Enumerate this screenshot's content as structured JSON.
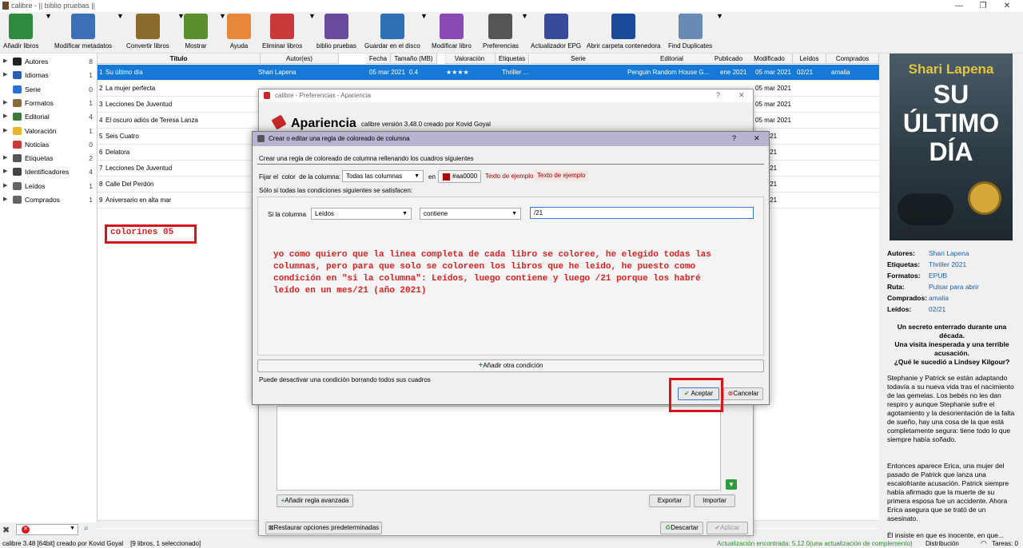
{
  "window": {
    "title": "calibre - || biblio pruebas ||",
    "min": "—",
    "max": "❐",
    "close": "✕"
  },
  "toolbar": [
    {
      "label": "Añadir libros",
      "color": "#2e8b3e",
      "dd": true
    },
    {
      "label": "Modificar metadatos",
      "color": "#3b6fb6",
      "dd": true
    },
    {
      "label": "Convertir libros",
      "color": "#8b6a2e",
      "dd": true
    },
    {
      "label": "Mostrar",
      "color": "#5a8f2e",
      "dd": true
    },
    {
      "label": "Ayuda",
      "color": "#e8873a",
      "dd": false
    },
    {
      "label": "Eliminar libros",
      "color": "#c93a3a",
      "dd": true
    },
    {
      "label": "biblio pruebas",
      "color": "#6a4a9a",
      "dd": false
    },
    {
      "label": "Guardar en el disco",
      "color": "#2e6fb6",
      "dd": true
    },
    {
      "label": "Modificar libro",
      "color": "#8a4ab6",
      "dd": false
    },
    {
      "label": "Preferencias",
      "color": "#555555",
      "dd": true
    },
    {
      "label": "Actualizador EPG",
      "color": "#3a4a9a",
      "dd": false
    },
    {
      "label": "Abrir carpeta contenedora",
      "color": "#1a4a9a",
      "dd": false
    },
    {
      "label": "Find Duplicates",
      "color": "#6a8ab6",
      "dd": true
    }
  ],
  "sidebar": [
    {
      "name": "Autores",
      "count": "8",
      "color": "#222222"
    },
    {
      "name": "Idiomas",
      "count": "1",
      "color": "#2e5fb6"
    },
    {
      "name": "Serie",
      "count": "0",
      "color": "#2e6fd6"
    },
    {
      "name": "Formatos",
      "count": "1",
      "color": "#8a6a3a"
    },
    {
      "name": "Editorial",
      "count": "4",
      "color": "#3a7a3a"
    },
    {
      "name": "Valoración",
      "count": "1",
      "color": "#e6b82e"
    },
    {
      "name": "Noticias",
      "count": "0",
      "color": "#c93a3a"
    },
    {
      "name": "Etiquetas",
      "count": "2",
      "color": "#555555"
    },
    {
      "name": "Identificadores",
      "count": "4",
      "color": "#444444"
    },
    {
      "name": "Leídos",
      "count": "1",
      "color": "#666666"
    },
    {
      "name": "Comprados",
      "count": "1",
      "color": "#666666"
    }
  ],
  "columns": [
    "Título",
    "Autor(es)",
    "Fecha",
    "Tamaño (MB)",
    "Valoración",
    "Etiquetas",
    "Serie",
    "Editorial",
    "Publicado",
    "Modificado",
    "Leídos",
    "Comprados"
  ],
  "rows": [
    {
      "n": "1",
      "title": "Su último día",
      "author": "Shari Lapena",
      "date": "05 mar 2021",
      "size": "0.4",
      "rating": "★★★★",
      "tags": "Thriller ...",
      "publisher": "Penguin Random House G...",
      "published": "ene 2021",
      "modified": "05 mar 2021",
      "read": "02/21",
      "bought": "amalia"
    },
    {
      "n": "2",
      "title": "La mujer perfecta",
      "author": "",
      "date": "",
      "size": "",
      "rating": "",
      "tags": "",
      "publisher": "",
      "published": "",
      "modified": "05 mar 2021",
      "read": "",
      "bought": ""
    },
    {
      "n": "3",
      "title": "Lecciones De Juventud",
      "author": "",
      "date": "",
      "size": "",
      "rating": "",
      "tags": "",
      "publisher": "",
      "published": "",
      "modified": "05 mar 2021",
      "read": "",
      "bought": ""
    },
    {
      "n": "4",
      "title": "El oscuro adiós de Teresa Lanza",
      "author": "",
      "date": "",
      "size": "",
      "rating": "",
      "tags": "",
      "publisher": "",
      "published": "",
      "modified": "05 mar 2021",
      "read": "",
      "bought": ""
    },
    {
      "n": "5",
      "title": "Seis Cuatro",
      "author": "",
      "date": "",
      "size": "",
      "rating": "",
      "tags": "",
      "publisher": "",
      "published": "",
      "modified": "ar 2021",
      "read": "",
      "bought": ""
    },
    {
      "n": "6",
      "title": "Delatora",
      "author": "",
      "date": "",
      "size": "",
      "rating": "",
      "tags": "",
      "publisher": "",
      "published": "",
      "modified": "ar 2021",
      "read": "",
      "bought": ""
    },
    {
      "n": "7",
      "title": "Lecciones De Juventud",
      "author": "",
      "date": "",
      "size": "",
      "rating": "",
      "tags": "",
      "publisher": "",
      "published": "",
      "modified": "ar 2021",
      "read": "",
      "bought": ""
    },
    {
      "n": "8",
      "title": "Calle Del Perdón",
      "author": "",
      "date": "",
      "size": "",
      "rating": "",
      "tags": "",
      "publisher": "",
      "published": "",
      "modified": "ar 2021",
      "read": "",
      "bought": ""
    },
    {
      "n": "9",
      "title": "Aniversario en alta mar",
      "author": "",
      "date": "",
      "size": "",
      "rating": "",
      "tags": "",
      "publisher": "",
      "published": "",
      "modified": "ar 2021",
      "read": "",
      "bought": ""
    }
  ],
  "annotation_label": "colorines 05",
  "cover": {
    "author": "Shari Lapena",
    "title1": "SU",
    "title2": "ÚLTIMO",
    "title3": "DÍA"
  },
  "details": {
    "autores_k": "Autores:",
    "autores_v": "Shari Lapena",
    "etiquetas_k": "Etiquetas:",
    "etiquetas_v": "Thriller 2021",
    "formatos_k": "Formatos:",
    "formatos_v": "EPUB",
    "ruta_k": "Ruta:",
    "ruta_v": "Pulsar para abrir",
    "comprados_k": "Comprados:",
    "comprados_v": "amalia",
    "leidos_k": "Leídos:",
    "leidos_v": "02/21",
    "bold1": "Un secreto enterrado durante una década.",
    "bold2": "Una visita inesperada y una terrible acusación.",
    "bold3": "¿Qué le sucedió a Lindsey Kilgour?",
    "p1": "Stephanie y Patrick se están adaptando todavía a su nueva vida tras el nacimiento de las gemelas. Los bebés no les dan respiro y aunque Stephanie sufre el agotamiento y la desorientación de la falta de sueño, hay una cosa de la que está completamente segura: tiene todo lo que siempre había soñado.",
    "p2": "Entonces aparece Erica, una mujer del pasado de Patrick que lanza una escalofriante acusación. Patrick siempre había afirmado que la muerte de su primera esposa fue un accidente. Ahora Erica asegura que se trató de un asesinato.",
    "p3": "Él insiste en que es inocente, en que..."
  },
  "prefs": {
    "title": "calibre - Preferencias - Apariencia",
    "heading": "Apariencia",
    "version": "calibre versión 3.48.0 creado por Kovid Goyal",
    "add_adv": "Añadir regla avanzada",
    "export": "Exportar",
    "import": "Importar",
    "restore": "Restaurar opciones predeterminadas",
    "discard": "Descartar",
    "apply": "Aplicar"
  },
  "rule": {
    "title": "Crear o editar una regla de coloreado de columna",
    "help": "?",
    "close": "✕",
    "intro": "Crear una regla de coloreado de columna rellenando los cuadros siguientes",
    "fix_label": "Fijar el  color  de la columna:",
    "column": "Todas las columnas",
    "en": "en",
    "color_hex": "#aa0000",
    "sample1": "Texto de ejemplo",
    "sample2": "Texto de ejemplo",
    "only_if": "Sólo si todas las condiciones siguientes se satisfacen:",
    "if_col": "Si la columna",
    "cond_col": "Leídos",
    "cond_op": "contiene",
    "cond_val": "/21",
    "note": "yo como quiero que la linea completa de cada libro se coloree, he elegido todas las columnas, pero para que solo se coloreen los libros que he leído, he puesto como condición en \"si la columna\": Leídos, luego contiene y luego /21 porque los habré leído en un mes/21 (año 2021)",
    "add_cond": "Añadir otra condición",
    "remove_hint": "Puede desactivar una condición borrando todos sus cuadros",
    "accept": "Aceptar",
    "cancel": "Cancelar"
  },
  "status": {
    "left": "calibre 3.48 [64bit] creado por Kovid Goyal    [9 libros, 1 seleccionado]",
    "update": "Actualización encontrada: 5.12.0(una actualización de complemento)",
    "dist": "Distribución",
    "tasks": "Tareas: 0"
  }
}
